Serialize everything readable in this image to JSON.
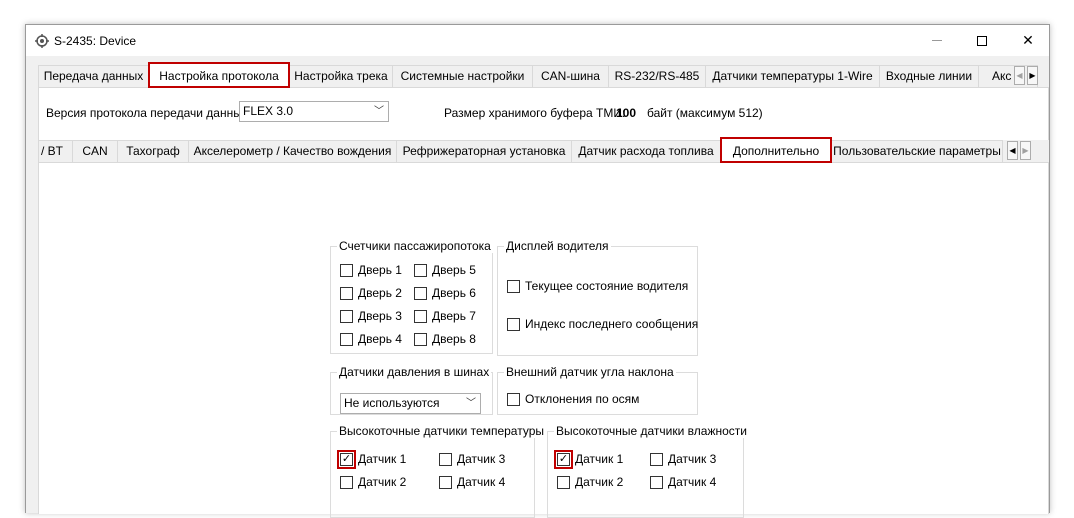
{
  "window": {
    "title": "S-2435: Device"
  },
  "top_tabs": [
    {
      "label": "Передача данных"
    },
    {
      "label": "Настройка протокола",
      "selected": true
    },
    {
      "label": "Настройка трека"
    },
    {
      "label": "Системные настройки"
    },
    {
      "label": "CAN-шина"
    },
    {
      "label": "RS-232/RS-485"
    },
    {
      "label": "Датчики температуры 1-Wire"
    },
    {
      "label": "Входные линии"
    },
    {
      "label": "Акс"
    }
  ],
  "protocol": {
    "version_label": "Версия протокола передачи данных",
    "version_value": "FLEX 3.0",
    "buffer_label": "Размер хранимого буфера ТМИ:",
    "buffer_value": "100",
    "buffer_unit": "байт (максимум 512)"
  },
  "sub_tabs": [
    {
      "label": "/ BT"
    },
    {
      "label": "CAN"
    },
    {
      "label": "Тахограф"
    },
    {
      "label": "Акселерометр / Качество вождения"
    },
    {
      "label": "Рефрижераторная установка"
    },
    {
      "label": "Датчик расхода топлива"
    },
    {
      "label": "Дополнительно",
      "selected": true
    },
    {
      "label": "Пользовательские параметры"
    }
  ],
  "passenger_counters": {
    "title": "Счетчики пассажиропотока",
    "items": [
      {
        "label": "Дверь 1",
        "checked": false
      },
      {
        "label": "Дверь 2",
        "checked": false
      },
      {
        "label": "Дверь 3",
        "checked": false
      },
      {
        "label": "Дверь 4",
        "checked": false
      },
      {
        "label": "Дверь 5",
        "checked": false
      },
      {
        "label": "Дверь 6",
        "checked": false
      },
      {
        "label": "Дверь 7",
        "checked": false
      },
      {
        "label": "Дверь 8",
        "checked": false
      }
    ]
  },
  "driver_display": {
    "title": "Дисплей водителя",
    "items": [
      {
        "label": "Текущее состояние водителя",
        "checked": false
      },
      {
        "label": "Индекс последнего сообщения",
        "checked": false
      }
    ]
  },
  "tire_pressure": {
    "title": "Датчики давления в шинах",
    "selected": "Не используются"
  },
  "tilt_sensor": {
    "title": "Внешний датчик угла наклона",
    "items": [
      {
        "label": "Отклонения по осям",
        "checked": false
      }
    ]
  },
  "hp_temperature": {
    "title": "Высокоточные датчики температуры",
    "items": [
      {
        "label": "Датчик 1",
        "checked": true
      },
      {
        "label": "Датчик 2",
        "checked": false
      },
      {
        "label": "Датчик 3",
        "checked": false
      },
      {
        "label": "Датчик 4",
        "checked": false
      }
    ]
  },
  "hp_humidity": {
    "title": "Высокоточные датчики влажности",
    "items": [
      {
        "label": "Датчик 1",
        "checked": true
      },
      {
        "label": "Датчик 2",
        "checked": false
      },
      {
        "label": "Датчик 3",
        "checked": false
      },
      {
        "label": "Датчик 4",
        "checked": false
      }
    ]
  },
  "colors": {
    "highlight": "#c00000",
    "panel": "#ffffff",
    "chrome": "#f0f0f0"
  }
}
